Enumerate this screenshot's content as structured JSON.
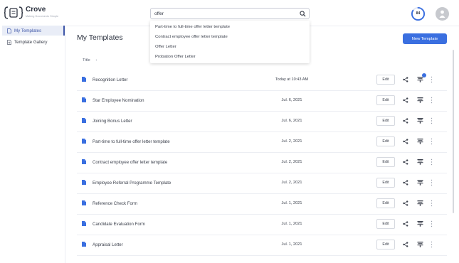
{
  "app": {
    "name": "Crove",
    "tagline": "Making Documents Simple",
    "progress_value": "84"
  },
  "search": {
    "value": "offer",
    "placeholder": "",
    "suggestions": [
      "Part-time to full-time offer letter template",
      "Contract employee offer letter template",
      "Offer Letter",
      "Probation Offer Letter"
    ]
  },
  "sidebar": {
    "items": [
      {
        "label": "My Templates",
        "active": true
      },
      {
        "label": "Template Gallery",
        "active": false
      }
    ]
  },
  "main": {
    "title": "My Templates",
    "new_button": "New Template",
    "column_title": "Title",
    "sort_glyph": "↕",
    "edit_label": "Edit",
    "rows": [
      {
        "title": "Recognition Letter",
        "date": "Today at 10:43 AM",
        "has_badge": true
      },
      {
        "title": "Star Employee Nomination",
        "date": "Jul. 6, 2021",
        "has_badge": false
      },
      {
        "title": "Joining Bonus Letter",
        "date": "Jul. 6, 2021",
        "has_badge": false
      },
      {
        "title": "Part-time to full-time offer letter template",
        "date": "Jul. 2, 2021",
        "has_badge": false
      },
      {
        "title": "Contract employee offer letter template",
        "date": "Jul. 2, 2021",
        "has_badge": false
      },
      {
        "title": "Employee Referral Programme Template",
        "date": "Jul. 2, 2021",
        "has_badge": false
      },
      {
        "title": "Reference Check Form",
        "date": "Jul. 1, 2021",
        "has_badge": false
      },
      {
        "title": "Candidate Evaluation Form",
        "date": "Jul. 1, 2021",
        "has_badge": false
      },
      {
        "title": "Appraisal Letter",
        "date": "Jul. 1, 2021",
        "has_badge": false
      }
    ]
  },
  "colors": {
    "accent": "#3a6fe0",
    "sidebar_active_bg": "#e9edf7",
    "progress_ring": "#3a6fe0"
  },
  "icons": {
    "logo": "crove-logo-icon",
    "search": "search-icon",
    "document": "document-icon",
    "share": "share-icon",
    "stack": "stack-icon",
    "more": "more-vertical-icon"
  }
}
